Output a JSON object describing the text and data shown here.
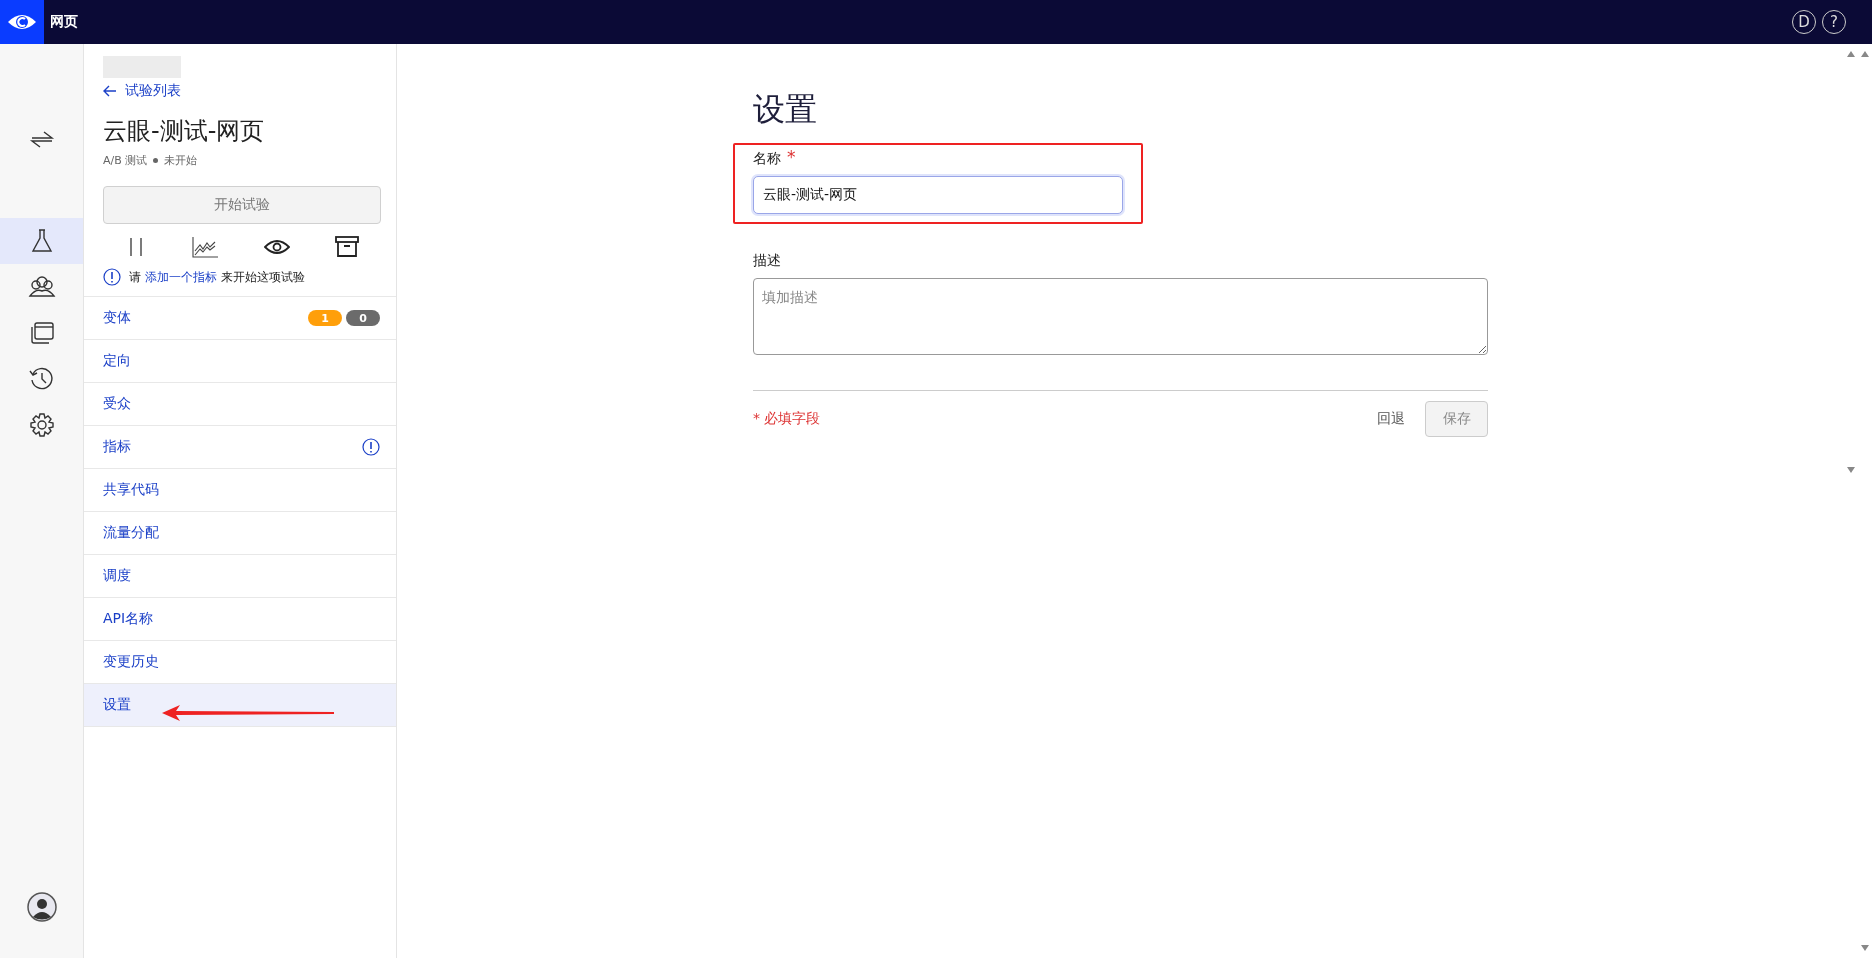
{
  "header": {
    "title": "网页",
    "user_initial": "D",
    "help": "?"
  },
  "rail": [
    {
      "kind": "swap",
      "selected": false
    },
    {
      "kind": "flask",
      "selected": true
    },
    {
      "kind": "people",
      "selected": false
    },
    {
      "kind": "windows",
      "selected": false
    },
    {
      "kind": "history",
      "selected": false
    },
    {
      "kind": "gear",
      "selected": false
    }
  ],
  "sidebar": {
    "back_link": "试验列表",
    "title": "云眼-测试-网页",
    "type": "A/B 测试",
    "status": "未开始",
    "start_button": {
      "label": "开始试验",
      "disabled": true
    },
    "notice": {
      "before": "请",
      "link": "添加一个指标",
      "after": "来开始这项试验"
    },
    "items": [
      {
        "label": "变体",
        "kind": "badges",
        "selected": false,
        "badges": [
          {
            "text": "1",
            "color": "#ff9f0a"
          },
          {
            "text": "0",
            "color": "#6b6b6b"
          }
        ]
      },
      {
        "label": "定向",
        "kind": "plain",
        "selected": false
      },
      {
        "label": "受众",
        "kind": "plain",
        "selected": false
      },
      {
        "label": "指标",
        "kind": "warning",
        "selected": false
      },
      {
        "label": "共享代码",
        "kind": "plain",
        "selected": false
      },
      {
        "label": "流量分配",
        "kind": "plain",
        "selected": false
      },
      {
        "label": "调度",
        "kind": "plain",
        "selected": false
      },
      {
        "label": "API名称",
        "kind": "plain",
        "selected": false
      },
      {
        "label": "变更历史",
        "kind": "plain",
        "selected": false
      },
      {
        "label": "设置",
        "kind": "plain",
        "selected": true
      }
    ]
  },
  "form": {
    "heading": "设置",
    "name_label": "名称",
    "required_mark": "*",
    "name_value": "云眼-测试-网页",
    "description_label": "描述",
    "description_placeholder": "填加描述",
    "required_note": "* 必填字段",
    "revert_button": "回退",
    "save_button": {
      "label": "保存",
      "disabled": true
    }
  }
}
